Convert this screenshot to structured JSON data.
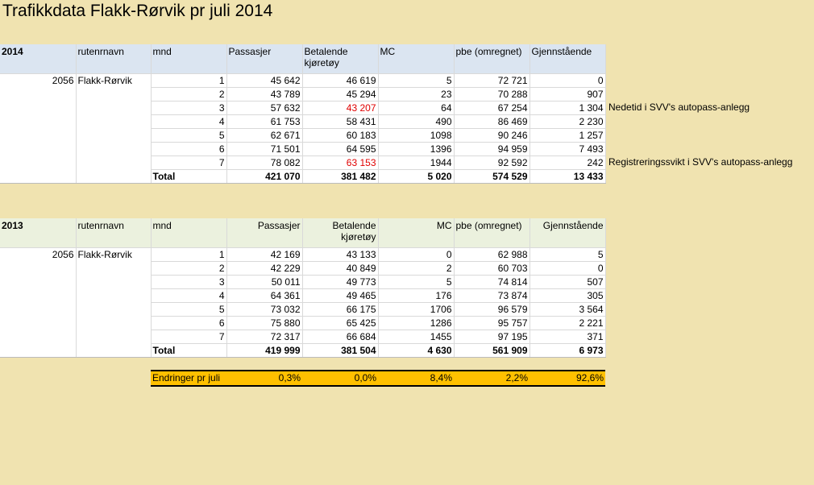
{
  "title": "Trafikkdata Flakk-Rørvik pr juli 2014",
  "headers": {
    "rutenrnavn": "rutenrnavn",
    "mnd": "mnd",
    "passasjer": "Passasjer",
    "betalende": "Betalende kjøretøy",
    "mc": "MC",
    "pbe": "pbe (omregnet)",
    "gjenstaende": "Gjennstående"
  },
  "t2014": {
    "year": "2014",
    "route_nr": "2056",
    "route_name": "Flakk-Rørvik",
    "rows": [
      {
        "mnd": "1",
        "passasjer": "45 642",
        "betalende": "46 619",
        "mc": "5",
        "pbe": "72 721",
        "gjen": "0"
      },
      {
        "mnd": "2",
        "passasjer": "43 789",
        "betalende": "45 294",
        "mc": "23",
        "pbe": "70 288",
        "gjen": "907"
      },
      {
        "mnd": "3",
        "passasjer": "57 632",
        "betalende": "43 207",
        "mc": "64",
        "pbe": "67 254",
        "gjen": "1 304"
      },
      {
        "mnd": "4",
        "passasjer": "61 753",
        "betalende": "58 431",
        "mc": "490",
        "pbe": "86 469",
        "gjen": "2 230"
      },
      {
        "mnd": "5",
        "passasjer": "62 671",
        "betalende": "60 183",
        "mc": "1098",
        "pbe": "90 246",
        "gjen": "1 257"
      },
      {
        "mnd": "6",
        "passasjer": "71 501",
        "betalende": "64 595",
        "mc": "1396",
        "pbe": "94 959",
        "gjen": "7 493"
      },
      {
        "mnd": "7",
        "passasjer": "78 082",
        "betalende": "63 153",
        "mc": "1944",
        "pbe": "92 592",
        "gjen": "242"
      }
    ],
    "total": {
      "label": "Total",
      "passasjer": "421 070",
      "betalende": "381 482",
      "mc": "5 020",
      "pbe": "574 529",
      "gjen": "13 433"
    },
    "notes": {
      "m3": "Nedetid i SVV's autopass-anlegg",
      "m7": "Registreringssvikt i SVV's autopass-anlegg"
    },
    "highlight_color": "#e00000"
  },
  "t2013": {
    "year": "2013",
    "route_nr": "2056",
    "route_name": "Flakk-Rørvik",
    "rows": [
      {
        "mnd": "1",
        "passasjer": "42 169",
        "betalende": "43 133",
        "mc": "0",
        "pbe": "62 988",
        "gjen": "5"
      },
      {
        "mnd": "2",
        "passasjer": "42 229",
        "betalende": "40 849",
        "mc": "2",
        "pbe": "60 703",
        "gjen": "0"
      },
      {
        "mnd": "3",
        "passasjer": "50 011",
        "betalende": "49 773",
        "mc": "5",
        "pbe": "74 814",
        "gjen": "507"
      },
      {
        "mnd": "4",
        "passasjer": "64 361",
        "betalende": "49 465",
        "mc": "176",
        "pbe": "73 874",
        "gjen": "305"
      },
      {
        "mnd": "5",
        "passasjer": "73 032",
        "betalende": "66 175",
        "mc": "1706",
        "pbe": "96 579",
        "gjen": "3 564"
      },
      {
        "mnd": "6",
        "passasjer": "75 880",
        "betalende": "65 425",
        "mc": "1286",
        "pbe": "95 757",
        "gjen": "2 221"
      },
      {
        "mnd": "7",
        "passasjer": "72 317",
        "betalende": "66 684",
        "mc": "1455",
        "pbe": "97 195",
        "gjen": "371"
      }
    ],
    "total": {
      "label": "Total",
      "passasjer": "419 999",
      "betalende": "381 504",
      "mc": "4 630",
      "pbe": "561 909",
      "gjen": "6 973"
    }
  },
  "change": {
    "label": "Endringer pr juli",
    "passasjer": "0,3%",
    "betalende": "0,0%",
    "mc": "8,4%",
    "pbe": "2,2%",
    "gjen": "92,6%",
    "color": "#ffc000"
  }
}
